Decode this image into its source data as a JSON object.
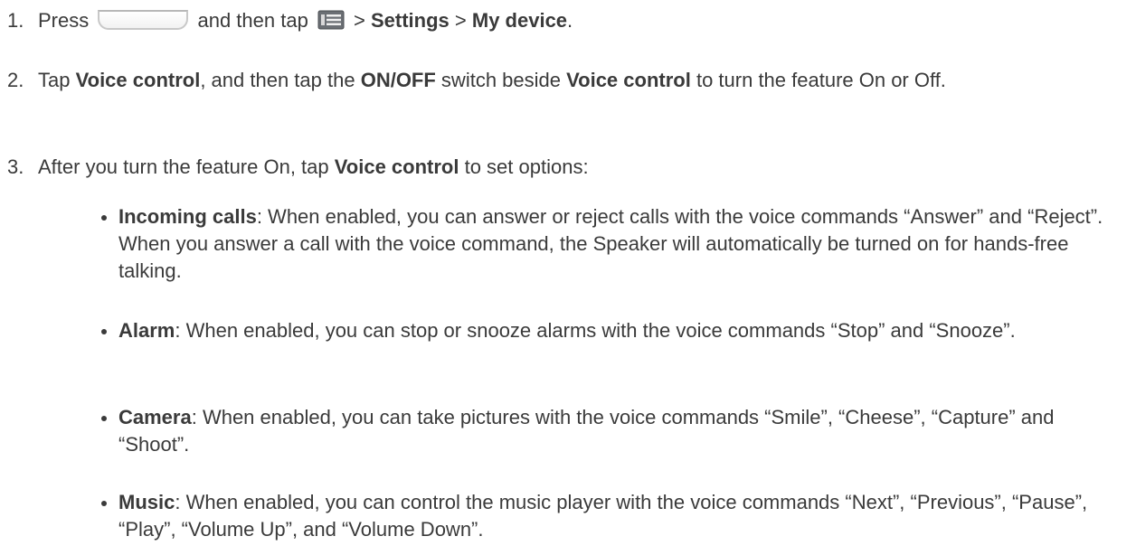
{
  "steps": [
    {
      "num": "1.",
      "t1": "Press ",
      "t2": " and then tap ",
      "t3": " > ",
      "b1": "Settings",
      "t4": " > ",
      "b2": "My device",
      "t5": "."
    },
    {
      "num": "2.",
      "t1": "Tap ",
      "b1": "Voice control",
      "t2": ", and then tap the ",
      "b2": "ON/OFF",
      "t3": " switch beside ",
      "b3": "Voice control",
      "t4": " to turn the feature On or Off."
    },
    {
      "num": "3.",
      "t1": "After you turn the feature On, tap ",
      "b1": "Voice control",
      "t2": " to set options:"
    }
  ],
  "bullets": [
    {
      "term": "Incoming calls",
      "text": ": When enabled, you can answer or reject calls with the voice commands “Answer” and “Reject”. When you answer a call with the voice command, the Speaker will automatically be turned on for hands-free talking."
    },
    {
      "term": "Alarm",
      "text": ": When enabled, you can stop or snooze alarms with the voice commands “Stop” and “Snooze”."
    },
    {
      "term": "Camera",
      "text": ": When enabled, you can take pictures with the voice commands “Smile”, “Cheese”, “Capture” and “Shoot”."
    },
    {
      "term": "Music",
      "text": ": When enabled, you can control the music player with the voice commands “Next”, “Previous”, “Pause”, “Play”, “Volume Up”, and “Volume Down”."
    }
  ],
  "icons": {
    "home_key": "home-key-icon",
    "menu_key": "menu-key-icon"
  },
  "colors": {
    "text": "#3a3a3a",
    "icon_border": "#c8c8c8"
  }
}
